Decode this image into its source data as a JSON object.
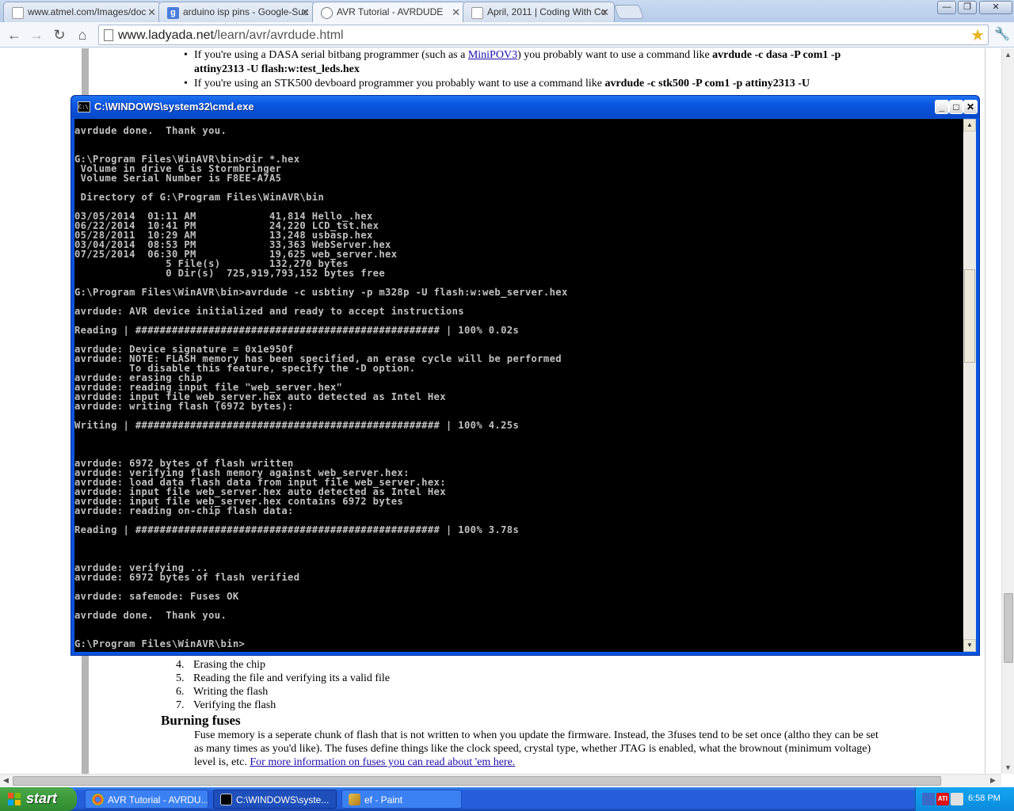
{
  "browser": {
    "tabs": [
      {
        "title": "www.atmel.com/Images/doc",
        "favicon": "page-icon"
      },
      {
        "title": "arduino isp pins - Google-Suc",
        "favicon": "google-icon"
      },
      {
        "title": "AVR Tutorial - AVRDUDE",
        "favicon": "ladyada-icon",
        "favicon_text": "ladyada"
      },
      {
        "title": "April, 2011 | Coding With Co",
        "favicon": "page-icon"
      }
    ],
    "address": {
      "domain": "www.ladyada.net",
      "path": "/learn/avr/avrdude.html"
    },
    "window_controls": {
      "minimize": "—",
      "restore": "❐",
      "close": "✕"
    },
    "nav": {
      "back": "←",
      "forward": "→",
      "reload": "↻",
      "home": "⌂"
    }
  },
  "page": {
    "bullets": [
      {
        "pre": "If you're using a DASA serial bitbang programmer (such as a ",
        "link": "MiniPOV3",
        "post": ") you probably want to use a command like ",
        "cmd": "avrdude -c dasa -P com1 -p attiny2313 -U flash:w:test_leds.hex"
      },
      {
        "pre": "If you're using an STK500 devboard programmer you probably want to use a command like ",
        "cmd": "avrdude -c stk500 -P com1 -p attiny2313 -U"
      }
    ],
    "steps": [
      {
        "num": "4",
        "text": "Erasing the chip"
      },
      {
        "num": "5",
        "text": "Reading the file and verifying its a valid file"
      },
      {
        "num": "6",
        "text": "Writing the flash"
      },
      {
        "num": "7",
        "text": "Verifying the flash"
      }
    ],
    "heading": "Burning fuses",
    "para": "Fuse memory is a seperate chunk of flash that is not written to when you update the firmware. Instead, the 3fuses tend to be set once (altho they can be set as many times as you'd like). The fuses define things like the clock speed, crystal type, whether JTAG is enabled, what the brownout (minimum voltage) level is, etc. ",
    "para_link": "For more information on fuses you can read about 'em here."
  },
  "cmd": {
    "title": "C:\\WINDOWS\\system32\\cmd.exe",
    "icon_text": "C:\\",
    "controls": {
      "minimize": "_",
      "maximize": "□",
      "close": "✕"
    },
    "lines": [
      "avrdude done.  Thank you.",
      "",
      "",
      "G:\\Program Files\\WinAVR\\bin>dir *.hex",
      " Volume in drive G is Stormbringer",
      " Volume Serial Number is F8EE-A7A5",
      "",
      " Directory of G:\\Program Files\\WinAVR\\bin",
      "",
      "03/05/2014  01:11 AM            41,814 Hello_.hex",
      "06/22/2014  10:41 PM            24,220 LCD_tst.hex",
      "05/28/2011  10:29 AM            13,248 usbasp.hex",
      "03/04/2014  08:53 PM            33,363 WebServer.hex",
      "07/25/2014  06:30 PM            19,625 web_server.hex",
      "               5 File(s)        132,270 bytes",
      "               0 Dir(s)  725,919,793,152 bytes free",
      "",
      "G:\\Program Files\\WinAVR\\bin>avrdude -c usbtiny -p m328p -U flash:w:web_server.hex",
      "",
      "avrdude: AVR device initialized and ready to accept instructions",
      "",
      "Reading | ################################################## | 100% 0.02s",
      "",
      "avrdude: Device signature = 0x1e950f",
      "avrdude: NOTE: FLASH memory has been specified, an erase cycle will be performed",
      "         To disable this feature, specify the -D option.",
      "avrdude: erasing chip",
      "avrdude: reading input file \"web_server.hex\"",
      "avrdude: input file web_server.hex auto detected as Intel Hex",
      "avrdude: writing flash (6972 bytes):",
      "",
      "Writing | ################################################## | 100% 4.25s",
      "",
      "",
      "",
      "avrdude: 6972 bytes of flash written",
      "avrdude: verifying flash memory against web_server.hex:",
      "avrdude: load data flash data from input file web_server.hex:",
      "avrdude: input file web_server.hex auto detected as Intel Hex",
      "avrdude: input file web_server.hex contains 6972 bytes",
      "avrdude: reading on-chip flash data:",
      "",
      "Reading | ################################################## | 100% 3.78s",
      "",
      "",
      "",
      "avrdude: verifying ...",
      "avrdude: 6972 bytes of flash verified",
      "",
      "avrdude: safemode: Fuses OK",
      "",
      "avrdude done.  Thank you.",
      "",
      "",
      "G:\\Program Files\\WinAVR\\bin>"
    ]
  },
  "taskbar": {
    "start": "start",
    "buttons": [
      {
        "label": "AVR Tutorial - AVRDU...",
        "icon": "chrome-icon",
        "active": false
      },
      {
        "label": "C:\\WINDOWS\\syste...",
        "icon": "cmd-icon",
        "active": true
      },
      {
        "label": "ef - Paint",
        "icon": "paint-icon",
        "active": false
      }
    ],
    "tray_ati": "ATI",
    "clock": "6:58 PM"
  },
  "colors": {
    "xp_blue": "#245edb",
    "start_green": "#3c9a3c",
    "console_text": "#c0c0c0",
    "link": "#1a0dab"
  }
}
